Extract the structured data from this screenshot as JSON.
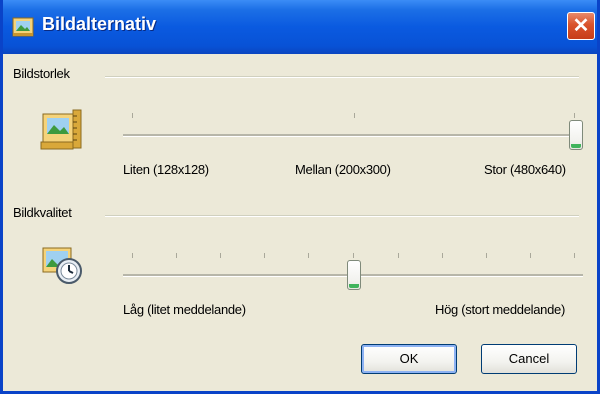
{
  "window": {
    "title": "Bildalternativ",
    "icon": "image-options-icon",
    "close_icon": "close-icon"
  },
  "size_group": {
    "label": "Bildstorlek",
    "icon": "image-size-icon",
    "slider": {
      "min_label": "Liten (128x128)",
      "mid_label": "Mellan (200x300)",
      "max_label": "Stor (480x640)",
      "positions": 3,
      "selected_index": 2
    }
  },
  "quality_group": {
    "label": "Bildkvalitet",
    "icon": "image-quality-icon",
    "slider": {
      "min_label": "Låg (litet meddelande)",
      "max_label": "Hög (stort meddelande)",
      "positions": 11,
      "selected_index": 5
    }
  },
  "buttons": {
    "ok": "OK",
    "cancel": "Cancel"
  },
  "colors": {
    "titlebar": "#0a5ae0",
    "close_button": "#d9532c",
    "dialog_background": "#ece9d8",
    "slider_thumb_accent": "#3fb35b"
  }
}
